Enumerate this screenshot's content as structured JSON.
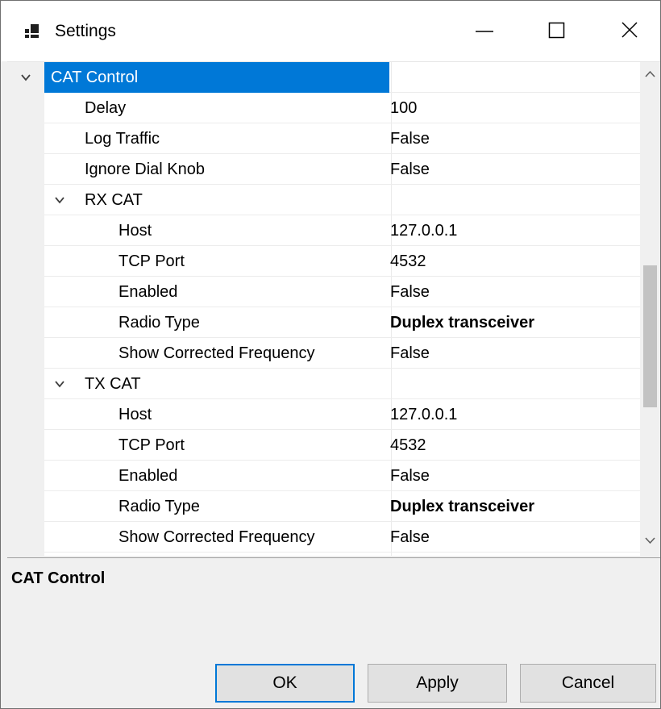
{
  "window": {
    "title": "Settings",
    "icons": {
      "app": "app-icon",
      "minimize": "minimize-icon",
      "maximize": "maximize-icon",
      "close": "close-icon"
    }
  },
  "grid": {
    "rows": [
      {
        "name": "CAT Control",
        "value": "",
        "level": 0,
        "expandable": true,
        "selected": true
      },
      {
        "name": "Delay",
        "value": "100",
        "level": 1
      },
      {
        "name": "Log Traffic",
        "value": "False",
        "level": 1
      },
      {
        "name": "Ignore Dial Knob",
        "value": "False",
        "level": 1
      },
      {
        "name": "RX CAT",
        "value": "",
        "level": 1,
        "expandable": true
      },
      {
        "name": "Host",
        "value": "127.0.0.1",
        "level": 2
      },
      {
        "name": "TCP Port",
        "value": "4532",
        "level": 2
      },
      {
        "name": "Enabled",
        "value": "False",
        "level": 2
      },
      {
        "name": "Radio Type",
        "value": "Duplex transceiver",
        "level": 2,
        "bold": true
      },
      {
        "name": "Show Corrected Frequency",
        "value": "False",
        "level": 2
      },
      {
        "name": "TX CAT",
        "value": "",
        "level": 1,
        "expandable": true
      },
      {
        "name": "Host",
        "value": "127.0.0.1",
        "level": 2
      },
      {
        "name": "TCP Port",
        "value": "4532",
        "level": 2
      },
      {
        "name": "Enabled",
        "value": "False",
        "level": 2
      },
      {
        "name": "Radio Type",
        "value": "Duplex transceiver",
        "level": 2,
        "bold": true
      },
      {
        "name": "Show Corrected Frequency",
        "value": "False",
        "level": 2
      }
    ]
  },
  "description": {
    "title": "CAT Control"
  },
  "buttons": {
    "ok": "OK",
    "apply": "Apply",
    "cancel": "Cancel"
  },
  "colors": {
    "selection": "#0078d7",
    "gutter": "#f0f0f0",
    "scroll_thumb": "#c2c2c2"
  }
}
